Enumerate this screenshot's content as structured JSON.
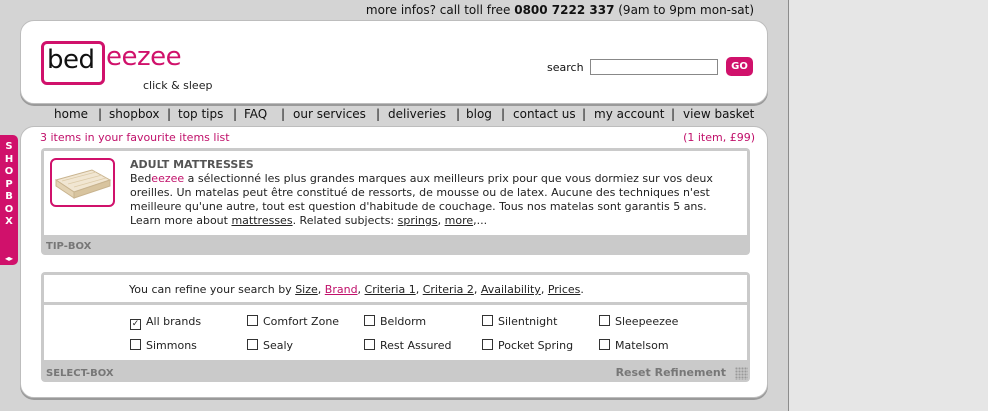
{
  "infobar": {
    "prefix": "more infos? call toll free",
    "phone": "0800 7222 337",
    "hours": "(9am to 9pm mon-sat)"
  },
  "logo": {
    "bed": "bed",
    "eezee": "eezee",
    "tagline": "click & sleep"
  },
  "search": {
    "label": "search",
    "value": "",
    "button": "GO"
  },
  "nav": [
    "home",
    "shopbox",
    "top tips",
    "FAQ",
    "our services",
    "deliveries",
    "blog",
    "contact us",
    "my account",
    "view basket"
  ],
  "favourites": {
    "text": "3 items in your favourite items list",
    "count": "(1 item, £99)"
  },
  "tipbox": {
    "title": "ADULT MATTRESSES",
    "brand_prefix": "Bed",
    "brand_suffix": "eezee",
    "body": " a sélectionné les plus grandes marques aux meilleurs prix pour que vous dormiez sur vos deux oreilles. Un matelas peut être constitué de ressorts, de mousse ou de latex. Aucune des techniques n'est meilleure qu'une autre, tout est question d'habitude de couchage. Tous nos matelas sont garantis 5 ans.",
    "learn_prefix": "Learn more about ",
    "learn_link": "mattresses",
    "related_prefix": ". Related subjects: ",
    "related_links": [
      "springs",
      "more"
    ],
    "ellipsis": ",...",
    "caption": "TIP-BOX"
  },
  "selectbox": {
    "refine_prefix": "You can refine your search by",
    "criteria": [
      "Size",
      "Brand",
      "Criteria 1",
      "Criteria 2",
      "Availability",
      "Prices"
    ],
    "caption": "SELECT-BOX",
    "reset": "Reset Refinement",
    "brands": [
      {
        "label": "All brands",
        "checked": true
      },
      {
        "label": "Comfort Zone",
        "checked": false
      },
      {
        "label": "Beldorm",
        "checked": false
      },
      {
        "label": "Silentnight",
        "checked": false
      },
      {
        "label": "Sleepeezee",
        "checked": false
      },
      {
        "label": "Simmons",
        "checked": false
      },
      {
        "label": "Sealy",
        "checked": false
      },
      {
        "label": "Rest Assured",
        "checked": false
      },
      {
        "label": "Pocket Spring",
        "checked": false
      },
      {
        "label": "Matelsom",
        "checked": false
      }
    ]
  },
  "shopbox_tab": {
    "label": "SHOPBOX",
    "arrows": "◂▸"
  },
  "colors": {
    "accent": "#d0116b",
    "background": "#d4d4d4",
    "panel": "#cacaca"
  }
}
